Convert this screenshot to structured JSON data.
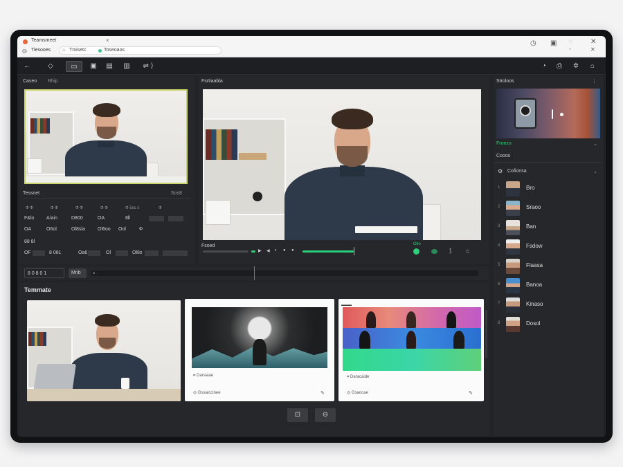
{
  "browser": {
    "tab_title": "Teamsmeet",
    "tab_close": "×",
    "addr_left": "Tiesooes",
    "url_a": "Tmisetc",
    "url_b": "Toseoaos",
    "icons": [
      "clock-icon",
      "save-icon",
      "account-icon",
      "close-icon"
    ]
  },
  "toolbar": {
    "back": "←",
    "tools": [
      "◇",
      "▭",
      "▣",
      "▤",
      "▥",
      "⇌ ⟩"
    ],
    "right": [
      "◔",
      "⎙",
      "✲",
      "⌂"
    ]
  },
  "left_panel": {
    "header_a": "Caseo",
    "header_b": "Rhip",
    "props_title": "Tessnet",
    "props_value": "Sos8",
    "row1": [
      "Ф Ф",
      "Ф Ф",
      "Ф Ф",
      "Ф Ф",
      "Ф 5sc s",
      "Ф"
    ],
    "row2": [
      "F&lo",
      "A/ain",
      "D800",
      "OA",
      "8ll",
      "8ll"
    ],
    "row3": [
      "OA",
      "O6ol",
      "Ol8sla",
      "Ol6oo",
      "Ool",
      "Ф"
    ],
    "row4_label": "88 8l",
    "row5": [
      "OF",
      "8 081",
      "Oa6",
      "Ol",
      "Ol8s"
    ]
  },
  "preview": {
    "title": "Fsrtiaabla",
    "scrub_label": "Fsoed",
    "controls": [
      "▶",
      "◀",
      "◐",
      "●",
      "●"
    ],
    "right_label": "Olio"
  },
  "timeline": {
    "timecode": "8 0 8 0 1",
    "mode": "Mnb"
  },
  "templates": {
    "title": "Temmate",
    "cards": [
      {
        "cap1": "",
        "cap2": ""
      },
      {
        "cap1": "Darsiaae",
        "cap2": "Gssaiccinee"
      },
      {
        "cap1": "Daracaide",
        "cap2": "Gsaocae"
      }
    ],
    "footer_buttons": [
      "⊡",
      "⊖"
    ]
  },
  "right_panel": {
    "header": "Stroloos",
    "dropdown": "Fronzo",
    "status": "Cooos",
    "section": "Cofionsa",
    "people": [
      {
        "num": "1",
        "name": "Bro"
      },
      {
        "num": "2",
        "name": "Sraoo"
      },
      {
        "num": "3",
        "name": "Ban"
      },
      {
        "num": "4",
        "name": "Fsdow"
      },
      {
        "num": "5",
        "name": "Flaasa"
      },
      {
        "num": "6",
        "name": "Banoa"
      },
      {
        "num": "7",
        "name": "Kinaso"
      },
      {
        "num": "8",
        "name": "Dosol"
      }
    ]
  },
  "colors": {
    "accent_green": "#2ecf7a",
    "accent_lime": "#c8d36a",
    "panel": "#26272a",
    "frame": "#111214"
  }
}
